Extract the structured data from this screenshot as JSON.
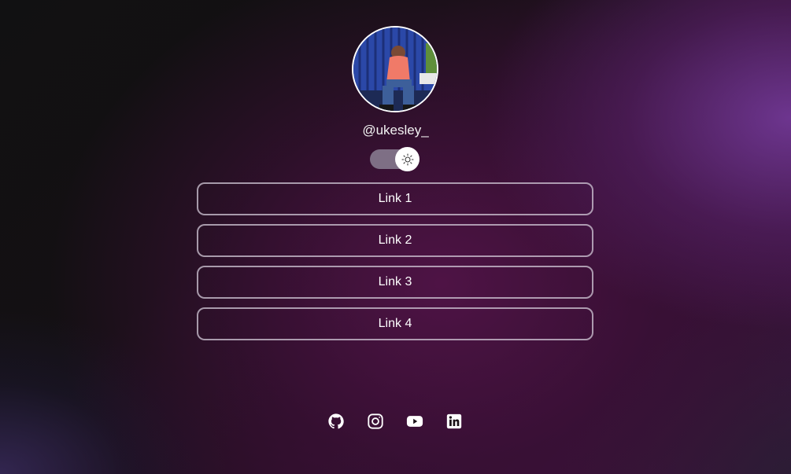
{
  "profile": {
    "username": "@ukesley_",
    "avatar_icon": "profile-photo"
  },
  "theme_toggle": {
    "icon": "sun-icon",
    "track_color": "#7e6f85",
    "knob_color": "#ffffff"
  },
  "links": [
    {
      "label": "Link 1"
    },
    {
      "label": "Link 2"
    },
    {
      "label": "Link 3"
    },
    {
      "label": "Link 4"
    }
  ],
  "social": [
    {
      "icon": "github-icon"
    },
    {
      "icon": "instagram-icon"
    },
    {
      "icon": "youtube-icon"
    },
    {
      "icon": "linkedin-icon"
    }
  ],
  "colors": {
    "text": "#ffffff",
    "button_border": "#d2c8d7",
    "accent_purple": "#783ca0",
    "background_dark": "#121214"
  }
}
